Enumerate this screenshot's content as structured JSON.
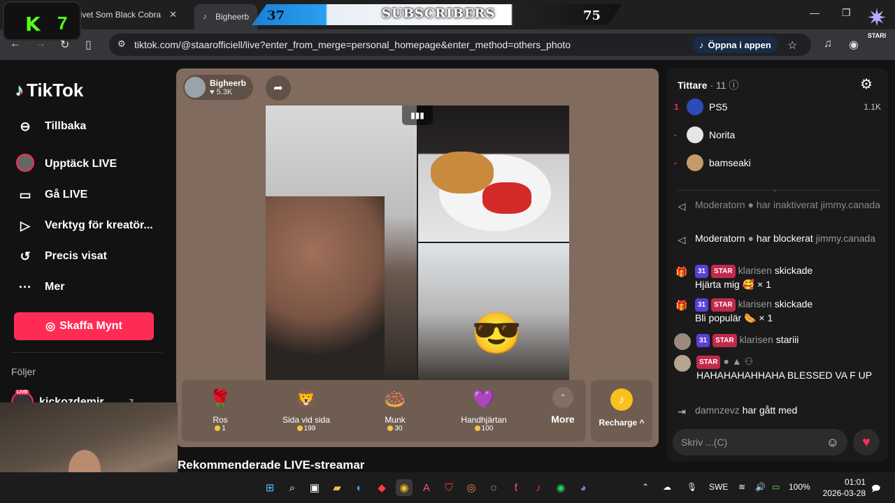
{
  "browser": {
    "tabs": [
      {
        "label": "Livet Som Black Cobra",
        "close": "✕"
      },
      {
        "label": "Bigheerb"
      }
    ],
    "url": "tiktok.com/@staarofficiell/live?enter_from_merge=personal_homepage&enter_method=others_photo",
    "open_in_app": "Öppna i appen"
  },
  "overlay": {
    "kick_count": "7",
    "sub_left": "37",
    "sub_title": "SUBSCRIBERS",
    "sub_right": "75",
    "stari_label": "STARI"
  },
  "sidebar": {
    "brand": "TikTok",
    "back": "Tillbaka",
    "items": [
      {
        "label": "Upptäck LIVE",
        "icon": "discover-live-icon"
      },
      {
        "label": "Gå LIVE",
        "icon": "camera-icon"
      },
      {
        "label": "Verktyg för kreatör...",
        "icon": "creator-tools-icon"
      },
      {
        "label": "Precis visat",
        "icon": "history-icon"
      },
      {
        "label": "Mer",
        "icon": "more-dots-icon"
      }
    ],
    "coins_button": "Skaffa Mynt",
    "following_heading": "Följer",
    "following": [
      {
        "name": "kickozdemir",
        "badge": "LIVE",
        "count": "7"
      }
    ]
  },
  "stage": {
    "host_name": "Bigheerb",
    "host_likes": "5.3K",
    "gifts": [
      {
        "name": "Ros",
        "price": "1",
        "icon": "🌹"
      },
      {
        "name": "Sida vid sida",
        "price": "199",
        "icon": "🦁"
      },
      {
        "name": "Munk",
        "price": "30",
        "icon": "🍩"
      },
      {
        "name": "Handhjärtan",
        "price": "100",
        "icon": "💜"
      }
    ],
    "more_label": "More",
    "recharge_label": "Recharge ^"
  },
  "recommend_title": "Rekommenderade LIVE-streamar",
  "chat": {
    "viewers_title": "Tittare",
    "viewers_count": "· 11",
    "viewers": [
      {
        "rank": "1",
        "name": "PS5",
        "score": "1.1K",
        "color": "#2b4bb8"
      },
      {
        "rank": "-",
        "name": "Norita",
        "score": "",
        "color": "#e6e6e6"
      },
      {
        "rank": "-",
        "name": "bamseaki",
        "score": "",
        "color": "#c79a6a"
      }
    ],
    "messages": [
      {
        "user": "Moderatorn",
        "text": "har inaktiverat",
        "target": "jimmy.canada",
        "faded": true
      },
      {
        "user": "Moderatorn",
        "text": "har blockerat",
        "target": "jimmy.canada"
      },
      {
        "lvl": "31",
        "star": "STAR",
        "user": "klarisen",
        "text": "skickade",
        "gift_line": "Hjärta mig 🥰 × 1"
      },
      {
        "lvl": "31",
        "star": "STAR",
        "user": "klarisen",
        "text": "skickade",
        "gift_line": "Bli populär 🌭 × 1"
      },
      {
        "lvl": "31",
        "star": "STAR",
        "user": "klarisen",
        "text": "stariii"
      },
      {
        "star": "STAR",
        "text": "HAHAHAHAHHAHA BLESSED VA F UP"
      },
      {
        "user": "damnzevz",
        "text": "har gått med"
      }
    ],
    "input_placeholder": "Skriv ...(C)"
  },
  "taskbar": {
    "language": "SWE",
    "battery": "100%",
    "time": "01:01",
    "date": "2026-03-28"
  }
}
